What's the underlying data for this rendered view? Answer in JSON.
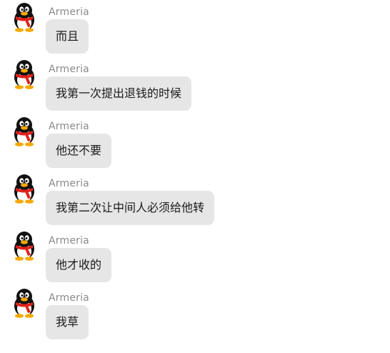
{
  "colors": {
    "background": "#ffffff",
    "bubble": "#e6e6e6",
    "sender_text": "#8a8a8a",
    "message_text": "#1a1a1a"
  },
  "messages": [
    {
      "sender": "Armeria",
      "avatar_icon": "qq-penguin-icon",
      "text": "而且"
    },
    {
      "sender": "Armeria",
      "avatar_icon": "qq-penguin-icon",
      "text": "我第一次提出退钱的时候"
    },
    {
      "sender": "Armeria",
      "avatar_icon": "qq-penguin-icon",
      "text": "他还不要"
    },
    {
      "sender": "Armeria",
      "avatar_icon": "qq-penguin-icon",
      "text": "我第二次让中间人必须给他转"
    },
    {
      "sender": "Armeria",
      "avatar_icon": "qq-penguin-icon",
      "text": "他才收的"
    },
    {
      "sender": "Armeria",
      "avatar_icon": "qq-penguin-icon",
      "text": "我草"
    }
  ]
}
